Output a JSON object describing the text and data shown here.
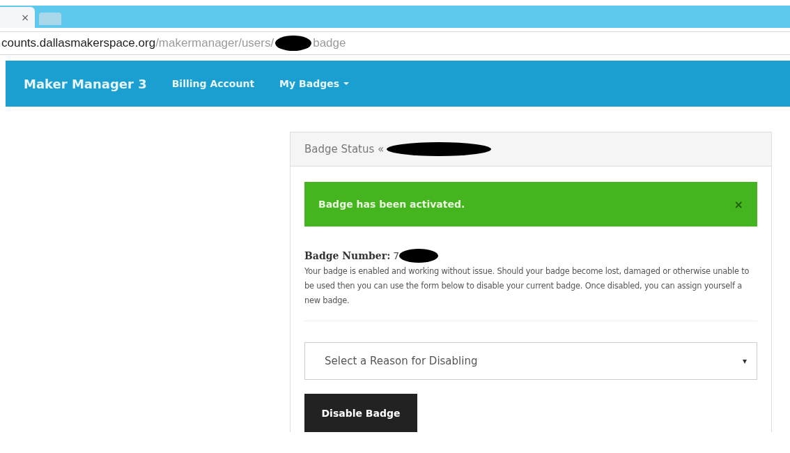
{
  "browser": {
    "tab_close": "×",
    "address": {
      "host": "counts.dallasmakerspace.org",
      "path": "/makermanager/users/",
      "suffix": "badge"
    }
  },
  "navbar": {
    "brand": "Maker Manager 3",
    "links": [
      {
        "label": "Billing Account",
        "dropdown": false
      },
      {
        "label": "My Badges",
        "dropdown": true
      }
    ]
  },
  "panel": {
    "heading": "Badge Status «",
    "alert": {
      "message": "Badge has been activated.",
      "close": "×"
    },
    "badge_label": "Badge Number:",
    "badge_number": "7",
    "description": "Your badge is enabled and working without issue. Should your badge become lost, damaged or otherwise unable to be used then you can use the form below to disable your current badge. Once disabled, you can assign yourself a new badge.",
    "select": {
      "placeholder": "Select a Reason for Disabling",
      "caret": "▾"
    },
    "button": "Disable Badge"
  }
}
